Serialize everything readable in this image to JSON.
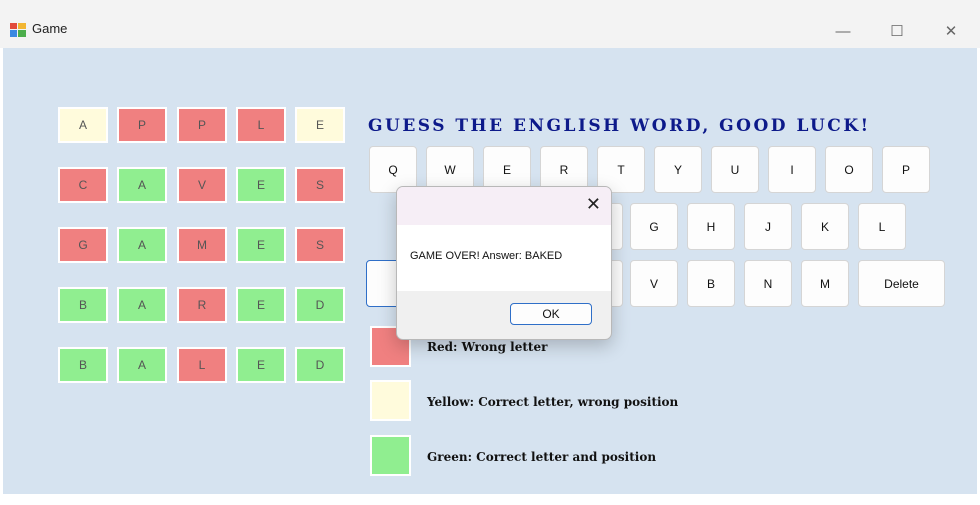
{
  "window": {
    "title": "Game"
  },
  "board": {
    "rows": [
      {
        "letters": [
          "A",
          "P",
          "P",
          "L",
          "E"
        ],
        "states": [
          "yellow",
          "red",
          "red",
          "red",
          "yellow"
        ]
      },
      {
        "letters": [
          "C",
          "A",
          "V",
          "E",
          "S"
        ],
        "states": [
          "red",
          "green",
          "red",
          "green",
          "red"
        ]
      },
      {
        "letters": [
          "G",
          "A",
          "M",
          "E",
          "S"
        ],
        "states": [
          "red",
          "green",
          "red",
          "green",
          "red"
        ]
      },
      {
        "letters": [
          "B",
          "A",
          "R",
          "E",
          "D"
        ],
        "states": [
          "green",
          "green",
          "red",
          "green",
          "green"
        ]
      },
      {
        "letters": [
          "B",
          "A",
          "L",
          "E",
          "D"
        ],
        "states": [
          "green",
          "green",
          "red",
          "green",
          "green"
        ]
      }
    ]
  },
  "heading": "GUESS THE ENGLISH WORD, GOOD LUCK!",
  "keyboard": {
    "row1": [
      "Q",
      "W",
      "E",
      "R",
      "T",
      "Y",
      "U",
      "I",
      "O",
      "P"
    ],
    "row2": [
      "G",
      "H",
      "J",
      "K",
      "L"
    ],
    "row3": [
      "V",
      "B",
      "N",
      "M"
    ],
    "delete_label": "Delete"
  },
  "legend": [
    {
      "color": "red",
      "label": "Red: Wrong letter"
    },
    {
      "color": "yellow",
      "label": "Yellow: Correct letter, wrong position"
    },
    {
      "color": "green",
      "label": "Green: Correct letter and position"
    }
  ],
  "dialog": {
    "message": "GAME OVER! Answer: BAKED",
    "ok_label": "OK",
    "close_glyph": "✕"
  },
  "window_controls": {
    "minimize": "—",
    "maximize": "☐",
    "close": "✕"
  },
  "colors": {
    "red": "#f08080",
    "green": "#90ee90",
    "yellow": "#fffbdc",
    "background": "#d6e3f0",
    "heading": "#0d1a8a"
  }
}
